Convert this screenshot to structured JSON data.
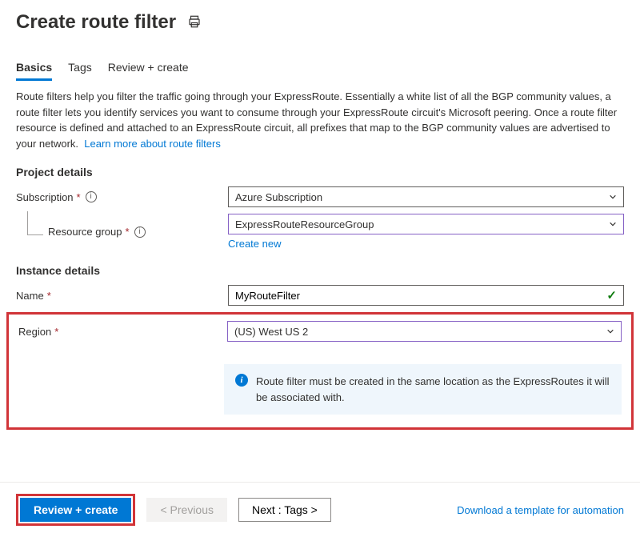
{
  "header": {
    "title": "Create route filter"
  },
  "tabs": {
    "basics": "Basics",
    "tags": "Tags",
    "review": "Review + create"
  },
  "description": {
    "text": "Route filters help you filter the traffic going through your ExpressRoute. Essentially a white list of all the BGP community values, a route filter lets you identify services you want to consume through your ExpressRoute circuit's Microsoft peering. Once a route filter resource is defined and attached to an ExpressRoute circuit, all prefixes that map to the BGP community values are advertised to your network.",
    "link": "Learn more about route filters"
  },
  "sections": {
    "project": "Project details",
    "instance": "Instance details"
  },
  "fields": {
    "subscription": {
      "label": "Subscription",
      "value": "Azure Subscription"
    },
    "resource_group": {
      "label": "Resource group",
      "value": "ExpressRouteResourceGroup",
      "create_link": "Create new"
    },
    "name": {
      "label": "Name",
      "value": "MyRouteFilter"
    },
    "region": {
      "label": "Region",
      "value": "(US) West US 2"
    }
  },
  "info_message": "Route filter must be created in the same location as the ExpressRoutes it will be associated with.",
  "footer": {
    "review": "Review + create",
    "previous": "< Previous",
    "next": "Next : Tags >",
    "template_link": "Download a template for automation"
  }
}
